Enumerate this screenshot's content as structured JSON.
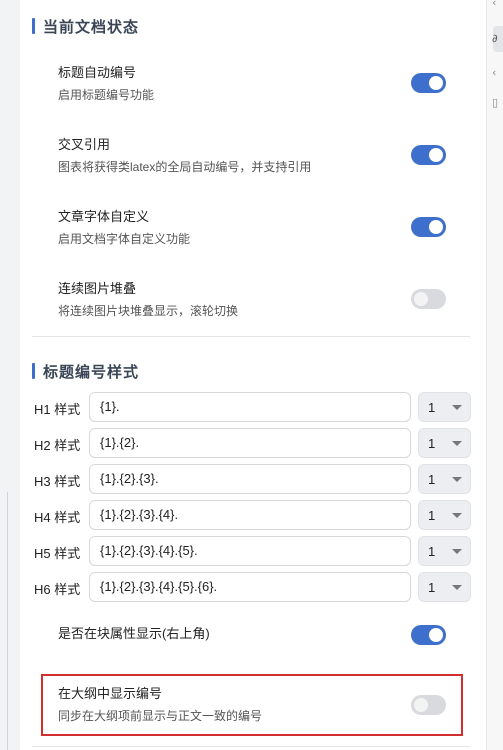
{
  "doc_status": {
    "section_title": "当前文档状态",
    "settings": [
      {
        "title": "标题自动编号",
        "desc": "启用标题编号功能",
        "enabled": true
      },
      {
        "title": "交叉引用",
        "desc": "图表将获得类latex的全局自动编号，并支持引用",
        "enabled": true
      },
      {
        "title": "文章字体自定义",
        "desc": "启用文档字体自定义功能",
        "enabled": true
      },
      {
        "title": "连续图片堆叠",
        "desc": "将连续图片块堆叠显示，滚轮切换",
        "enabled": false
      }
    ]
  },
  "heading_style": {
    "section_title": "标题编号样式",
    "rows": [
      {
        "label": "H1 样式",
        "format": "{1}.",
        "select": "1"
      },
      {
        "label": "H2 样式",
        "format": "{1}.{2}.",
        "select": "1"
      },
      {
        "label": "H3 样式",
        "format": "{1}.{2}.{3}.",
        "select": "1"
      },
      {
        "label": "H4 样式",
        "format": "{1}.{2}.{3}.{4}.",
        "select": "1"
      },
      {
        "label": "H5 样式",
        "format": "{1}.{2}.{3}.{4}.{5}.",
        "select": "1"
      },
      {
        "label": "H6 样式",
        "format": "{1}.{2}.{3}.{4}.{5}.{6}.",
        "select": "1"
      }
    ],
    "show_in_block_attr": {
      "title": "是否在块属性显示(右上角)",
      "enabled": true
    },
    "show_in_outline": {
      "title": "在大纲中显示编号",
      "desc": "同步在大纲项前显示与正文一致的编号",
      "enabled": false
    }
  },
  "colors": {
    "accent": "#3f6fcc",
    "highlight": "#d32f2f",
    "section_bar": "#3d6ec9"
  },
  "right_strip_icons": [
    "arrow-icon",
    "link-icon",
    "back-icon",
    "doc-icon"
  ]
}
